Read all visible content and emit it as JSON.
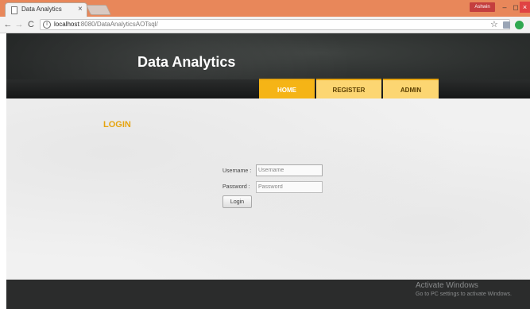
{
  "browser": {
    "tab_title": "Data Analytics",
    "tab_close": "×",
    "user_badge": "Ashwin",
    "window_controls": {
      "minimize": "–",
      "maximize": "◻",
      "close": "×"
    },
    "nav": {
      "back": "←",
      "forward": "→",
      "reload": "C"
    },
    "address": {
      "info": "i",
      "host": "localhost",
      "path": ":8080/DataAnalyticsAOTsql/"
    },
    "star": "☆",
    "icons": [
      "tab-page-icon",
      "info-icon",
      "star-icon",
      "extension-icon",
      "chrome-extension-green-icon"
    ]
  },
  "site": {
    "title": "Data Analytics",
    "nav": {
      "home": "HOME",
      "register": "REGISTER",
      "admin": "ADMIN"
    },
    "active_nav": "HOME"
  },
  "login": {
    "heading": "LOGIN",
    "username_label": "Username :",
    "username_placeholder": "Username",
    "password_label": "Password :",
    "password_placeholder": "Password",
    "button_label": "Login"
  },
  "os_watermark": {
    "title": "Activate Windows",
    "subtitle": "Go to PC settings to activate Windows."
  },
  "colors": {
    "tabstrip": "#e8875a",
    "accent": "#f5b416",
    "nav_tab": "#fcd672",
    "heading": "#e6a40f",
    "header_dark": "#2b2e2d",
    "footer": "#2b2c2c"
  }
}
